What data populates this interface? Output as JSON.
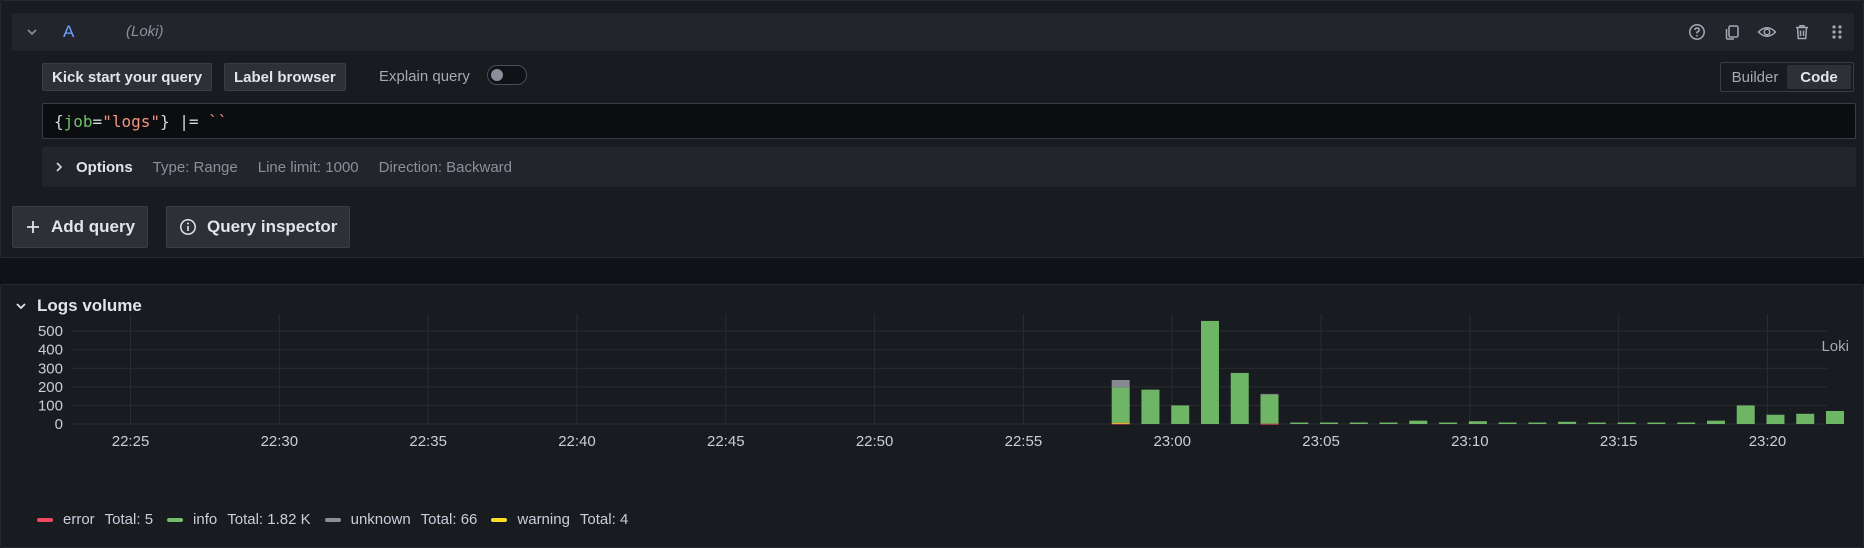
{
  "query": {
    "letter": "A",
    "datasource": "(Loki)",
    "toolbar": {
      "kick_start": "Kick start your query",
      "label_browser": "Label browser",
      "explain_query": "Explain query",
      "explain_enabled": false
    },
    "mode": {
      "builder": "Builder",
      "code": "Code",
      "active": "Code"
    },
    "editor": {
      "open_brace": "{",
      "label": "job",
      "eq": "=",
      "value": "\"logs\"",
      "close_brace": "}",
      "operator": " |= ",
      "pattern": "``"
    },
    "options": {
      "title": "Options",
      "type": "Type: Range",
      "line_limit": "Line limit: 1000",
      "direction": "Direction: Backward"
    }
  },
  "actions": {
    "add_query": "Add query",
    "query_inspector": "Query inspector"
  },
  "logs_volume": {
    "title": "Logs volume",
    "datasource_label": "Loki"
  },
  "chart_data": {
    "type": "bar",
    "stacked": true,
    "y_ticks": [
      0,
      100,
      200,
      300,
      400,
      500
    ],
    "ylim": [
      0,
      560
    ],
    "x_ticks": [
      "22:25",
      "22:30",
      "22:35",
      "22:40",
      "22:45",
      "22:50",
      "22:55",
      "23:00",
      "23:05",
      "23:10",
      "23:15",
      "23:20"
    ],
    "x_range": [
      "22:23",
      "23:22"
    ],
    "bucket_times": [
      "22:58",
      "22:59",
      "23:00",
      "23:01",
      "23:02",
      "23:03",
      "23:04",
      "23:05",
      "23:06",
      "23:07",
      "23:08",
      "23:09",
      "23:10",
      "23:11",
      "23:12",
      "23:13",
      "23:14",
      "23:15",
      "23:16",
      "23:17",
      "23:18",
      "23:19",
      "23:20",
      "23:21",
      "23:22"
    ],
    "series": [
      {
        "name": "error",
        "color": "#f2495c",
        "values": [
          3,
          0,
          0,
          0,
          0,
          2,
          0,
          0,
          0,
          0,
          0,
          0,
          0,
          0,
          0,
          0,
          0,
          0,
          0,
          0,
          0,
          0,
          0,
          0,
          0
        ]
      },
      {
        "name": "info",
        "color": "#73bf69",
        "values": [
          190,
          185,
          100,
          555,
          275,
          155,
          8,
          8,
          8,
          8,
          18,
          8,
          15,
          8,
          8,
          12,
          8,
          8,
          8,
          8,
          18,
          100,
          50,
          55,
          70
        ]
      },
      {
        "name": "unknown",
        "color": "#8e8e9a",
        "values": [
          40,
          0,
          0,
          0,
          0,
          5,
          0,
          0,
          0,
          0,
          0,
          0,
          0,
          0,
          0,
          0,
          0,
          0,
          0,
          0,
          0,
          0,
          0,
          0,
          0
        ]
      },
      {
        "name": "warning",
        "color": "#fade2a",
        "values": [
          4,
          0,
          0,
          0,
          0,
          0,
          0,
          0,
          0,
          0,
          0,
          0,
          0,
          0,
          0,
          0,
          0,
          0,
          0,
          0,
          0,
          0,
          0,
          0,
          0
        ]
      }
    ],
    "legend": [
      {
        "name": "error",
        "total": "Total: 5",
        "color": "#f2495c"
      },
      {
        "name": "info",
        "total": "Total: 1.82 K",
        "color": "#73bf69"
      },
      {
        "name": "unknown",
        "total": "Total: 66",
        "color": "#8e8e9a"
      },
      {
        "name": "warning",
        "total": "Total: 4",
        "color": "#fade2a"
      }
    ],
    "grid": true,
    "legend_placement": "bottom"
  }
}
